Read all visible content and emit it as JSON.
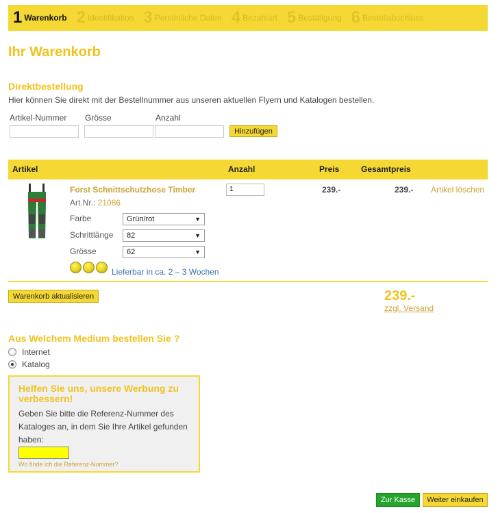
{
  "steps": [
    {
      "num": "1",
      "label": "Warenkorb"
    },
    {
      "num": "2",
      "label": "Identifikation"
    },
    {
      "num": "3",
      "label": "Persönliche Daten"
    },
    {
      "num": "4",
      "label": "Bezahlart"
    },
    {
      "num": "5",
      "label": "Bestätigung"
    },
    {
      "num": "6",
      "label": "Bestellabschluss"
    }
  ],
  "page_title": "Ihr Warenkorb",
  "direkt": {
    "heading": "Direktbestellung",
    "description": "Hier können Sie direkt mit der Bestellnummer aus unseren aktuellen Flyern und Katalogen bestellen.",
    "label_artikel": "Artikel-Nummer",
    "label_groesse": "Grösse",
    "label_anzahl": "Anzahl",
    "add_button": "Hinzufügen"
  },
  "table": {
    "col_artikel": "Artikel",
    "col_anzahl": "Anzahl",
    "col_preis": "Preis",
    "col_gesamt": "Gesamtpreis"
  },
  "item": {
    "name": "Forst Schnittschutzhose Timber",
    "artnr_label": "Art.Nr.:",
    "artnr": "21086",
    "quantity": "1",
    "price": "239.-",
    "total": "239.-",
    "delete": "Artikel löschen",
    "options": [
      {
        "label": "Farbe",
        "value": "Grün/rot"
      },
      {
        "label": "Schrittlänge",
        "value": "82"
      },
      {
        "label": "Grösse",
        "value": "62"
      }
    ],
    "availability": "Lieferbar in ca. 2 – 3 Wochen"
  },
  "update_button": "Warenkorb aktualisieren",
  "cart_total": "239.-",
  "versand": "zzgl. Versand",
  "medium": {
    "heading": "Aus Welchem Medium bestellen Sie ?",
    "options": [
      "Internet",
      "Katalog"
    ],
    "selected": "Katalog"
  },
  "help": {
    "heading": "Helfen Sie uns, unsere Werbung zu verbessern!",
    "text": "Geben Sie bitte die Referenz-Nummer des Kataloges an, in dem Sie Ihre Artikel gefunden haben:",
    "link": "Wo finde ich die Referenz-Nummer?"
  },
  "buttons": {
    "checkout": "Zur Kasse",
    "continue": "Weiter einkaufen"
  },
  "colors": {
    "accent_yellow": "#f5d833",
    "title_yellow": "#f2c21e",
    "link_gold": "#c9a43a",
    "checkout_green": "#25a52e"
  }
}
